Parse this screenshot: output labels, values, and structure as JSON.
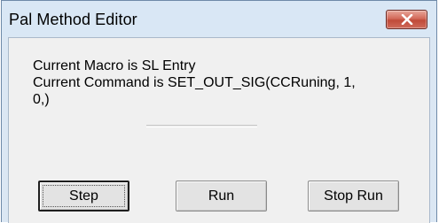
{
  "window": {
    "title": "Pal Method Editor"
  },
  "message": {
    "line1": "Current Macro is SL Entry",
    "line2": "Current Command is SET_OUT_SIG(CCRuning, 1,",
    "line3": "0,)"
  },
  "buttons": {
    "step": "Step",
    "run": "Run",
    "stop_run": "Stop Run"
  },
  "icons": {
    "close": "close-icon"
  },
  "colors": {
    "close_button": "#c9503f",
    "titlebar": "#d9e7f5",
    "client_bg": "#f0f0f0"
  }
}
